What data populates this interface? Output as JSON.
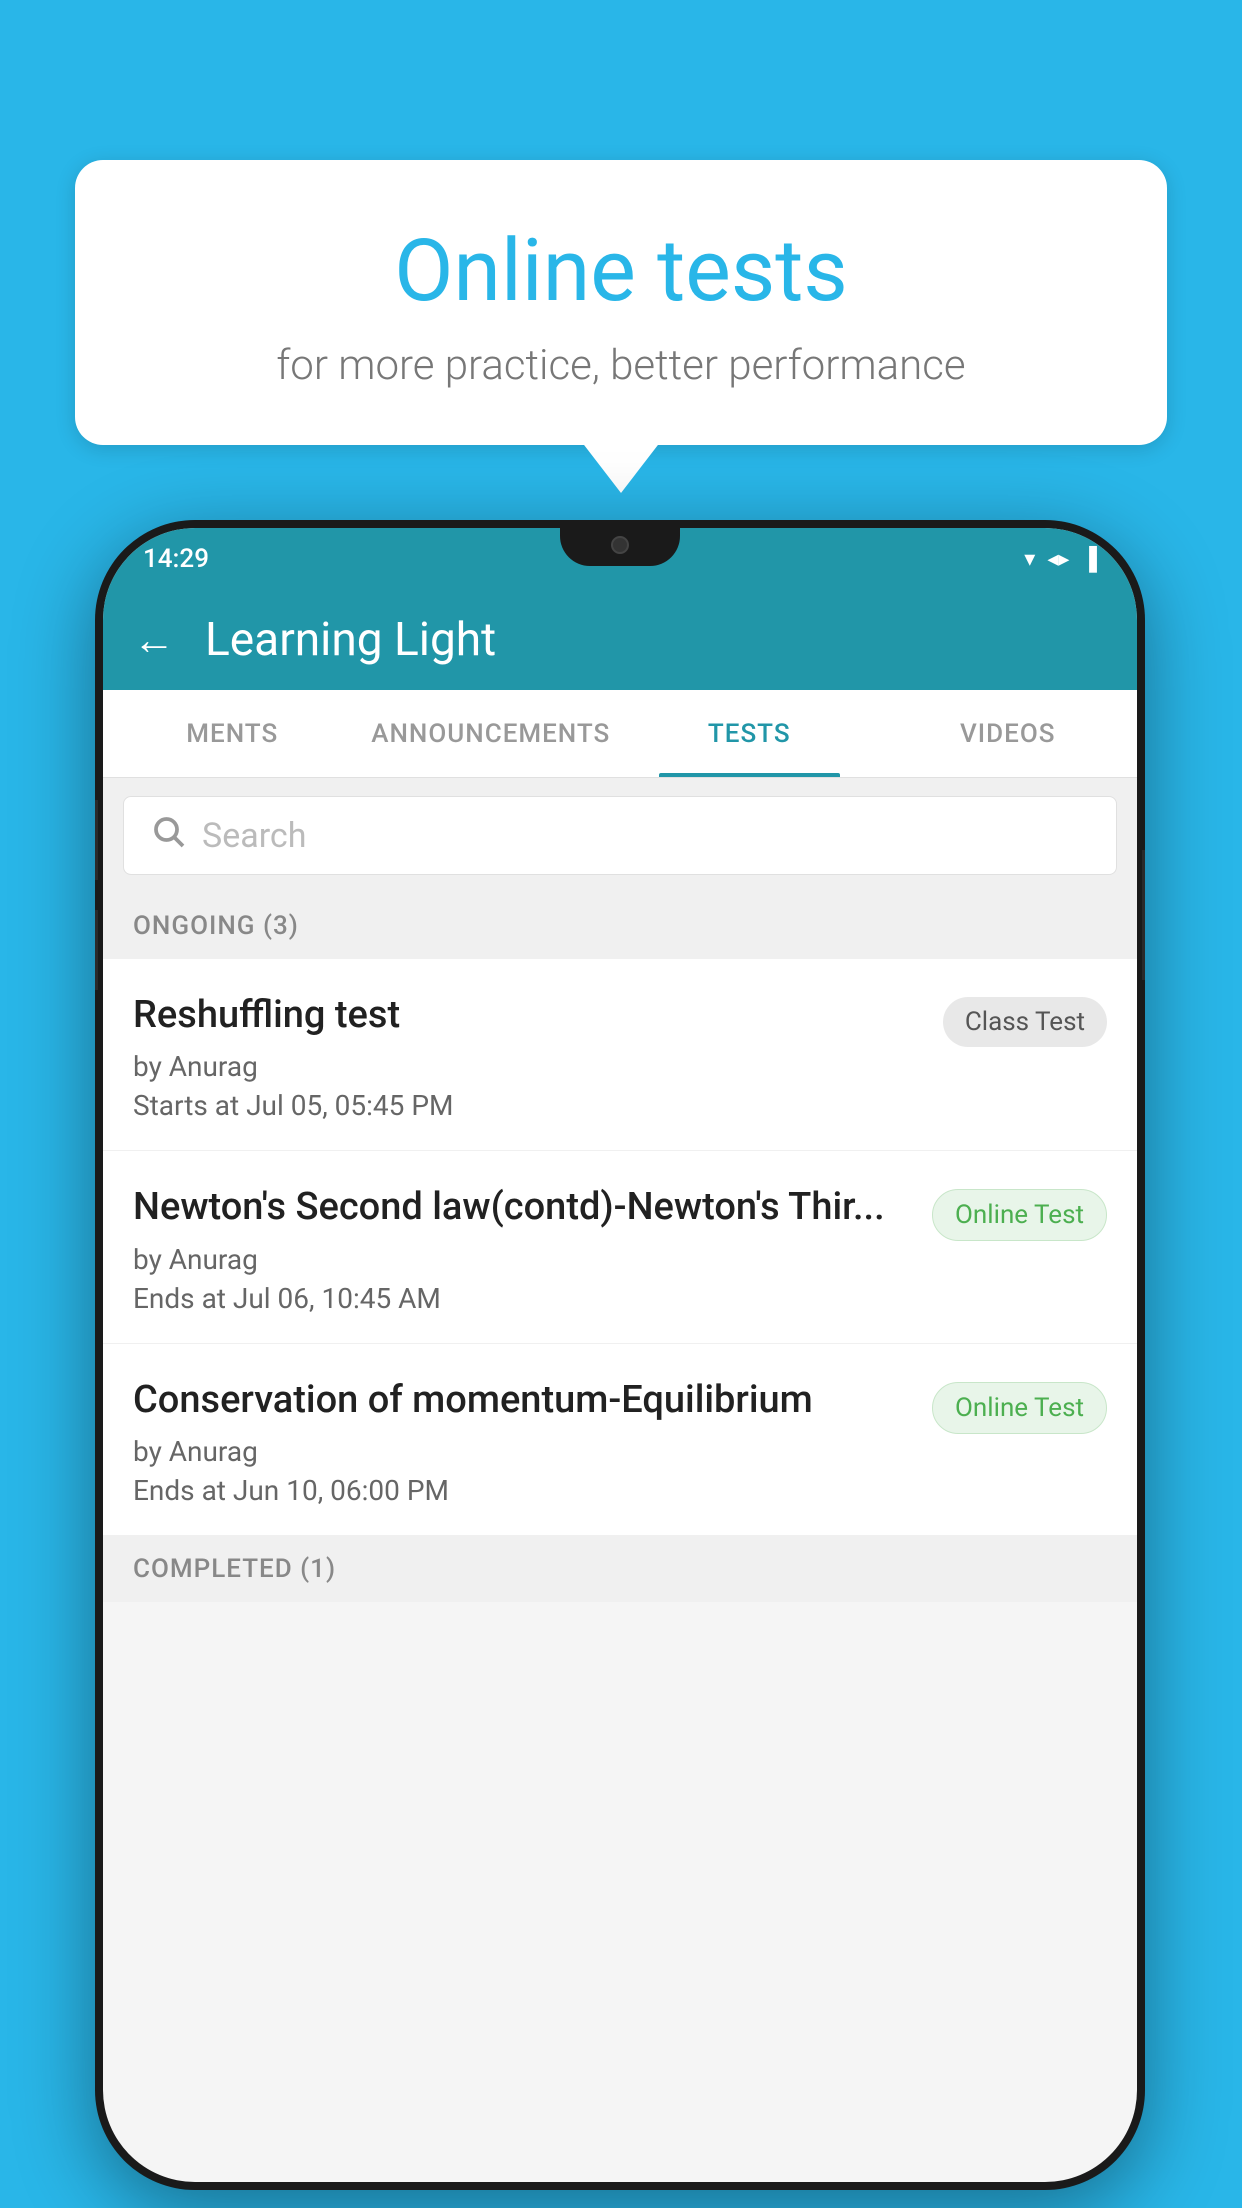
{
  "background": {
    "color": "#29b6e8"
  },
  "bubble": {
    "title": "Online tests",
    "subtitle": "for more practice, better performance"
  },
  "phone": {
    "status_bar": {
      "time": "14:29",
      "icons": "▾◂▐"
    },
    "app_bar": {
      "title": "Learning Light",
      "back_label": "←"
    },
    "tabs": [
      {
        "label": "MENTS",
        "active": false
      },
      {
        "label": "ANNOUNCEMENTS",
        "active": false
      },
      {
        "label": "TESTS",
        "active": true
      },
      {
        "label": "VIDEOS",
        "active": false
      }
    ],
    "search": {
      "placeholder": "Search"
    },
    "ongoing_section": {
      "label": "ONGOING (3)"
    },
    "tests": [
      {
        "name": "Reshuffling test",
        "author": "by Anurag",
        "time_label": "Starts at",
        "time": "Jul 05, 05:45 PM",
        "badge": "Class Test",
        "badge_type": "class"
      },
      {
        "name": "Newton's Second law(contd)-Newton's Thir...",
        "author": "by Anurag",
        "time_label": "Ends at",
        "time": "Jul 06, 10:45 AM",
        "badge": "Online Test",
        "badge_type": "online"
      },
      {
        "name": "Conservation of momentum-Equilibrium",
        "author": "by Anurag",
        "time_label": "Ends at",
        "time": "Jun 10, 06:00 PM",
        "badge": "Online Test",
        "badge_type": "online"
      }
    ],
    "completed_section": {
      "label": "COMPLETED (1)"
    }
  }
}
